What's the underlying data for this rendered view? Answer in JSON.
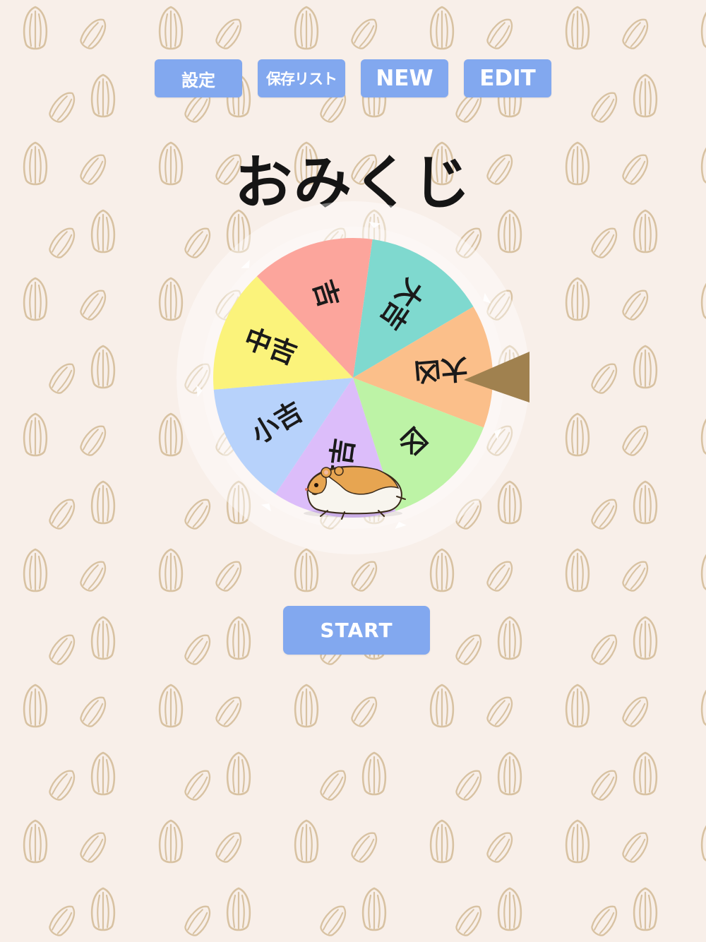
{
  "toolbar": {
    "settings_label": "設定",
    "saved_list_label": "保存リスト",
    "new_label": "NEW",
    "edit_label": "EDIT"
  },
  "title": "おみくじ",
  "wheel": {
    "segments": [
      {
        "label": "大吉",
        "color": "#7fd9cf"
      },
      {
        "label": "大凶",
        "color": "#fbbf8a"
      },
      {
        "label": "凶",
        "color": "#bdf3a6"
      },
      {
        "label": "末吉",
        "color": "#dcbdfa"
      },
      {
        "label": "小吉",
        "color": "#b7d2fb"
      },
      {
        "label": "中吉",
        "color": "#fbf37b"
      },
      {
        "label": "吉",
        "color": "#fca59c"
      }
    ],
    "pointer_color": "#a0814f",
    "decoration": "hamster-icon"
  },
  "start_label": "START",
  "colors": {
    "background": "#f8efe9",
    "button": "#82a8ef",
    "seed": "#d8c2a2"
  }
}
